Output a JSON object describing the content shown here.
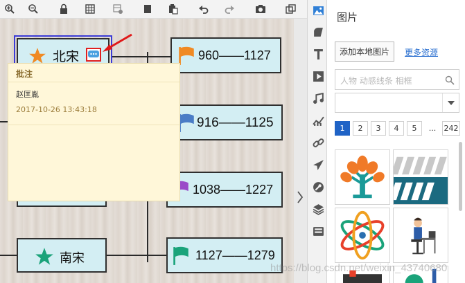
{
  "toolbar": {
    "icons": [
      "zoom-in-icon",
      "zoom-out-icon",
      "lock-icon",
      "grid-icon",
      "format-icon",
      "copy-icon",
      "paste-icon",
      "undo-icon",
      "redo-icon",
      "camera-icon",
      "fit-icon"
    ]
  },
  "canvas": {
    "nodes": [
      {
        "label": "北宋",
        "icon": "star-icon",
        "color": "#f08a24"
      },
      {
        "label": "南宋",
        "icon": "star-icon",
        "color": "#1aa37a"
      }
    ],
    "periods": [
      {
        "label": "960——1127",
        "flag_color": "#f08a24"
      },
      {
        "label": "916——1125",
        "flag_color": "#4a7cc6"
      },
      {
        "label": "1038——1227",
        "flag_color": "#9a4bc8"
      },
      {
        "label": "1127——1279",
        "flag_color": "#1aa37a"
      }
    ]
  },
  "comment_popup": {
    "title": "批注",
    "author": "赵匡胤",
    "time": "2017-10-26 13:43:18"
  },
  "sidebar_icons": [
    "image-icon",
    "shape-icon",
    "text-icon",
    "video-icon",
    "music-icon",
    "chart-icon",
    "link-icon",
    "plane-icon",
    "wrench-icon",
    "layers-icon",
    "storage-icon"
  ],
  "panel": {
    "title": "图片",
    "add_local_label": "添加本地图片",
    "more_resources_label": "更多资源",
    "search_placeholder": "人物 动感线条 相框",
    "category_value": "",
    "pages": [
      "1",
      "2",
      "3",
      "4",
      "5",
      "...",
      "242"
    ],
    "active_page": "1"
  },
  "watermark": "https://blog.csdn.net/weixin_43740680"
}
